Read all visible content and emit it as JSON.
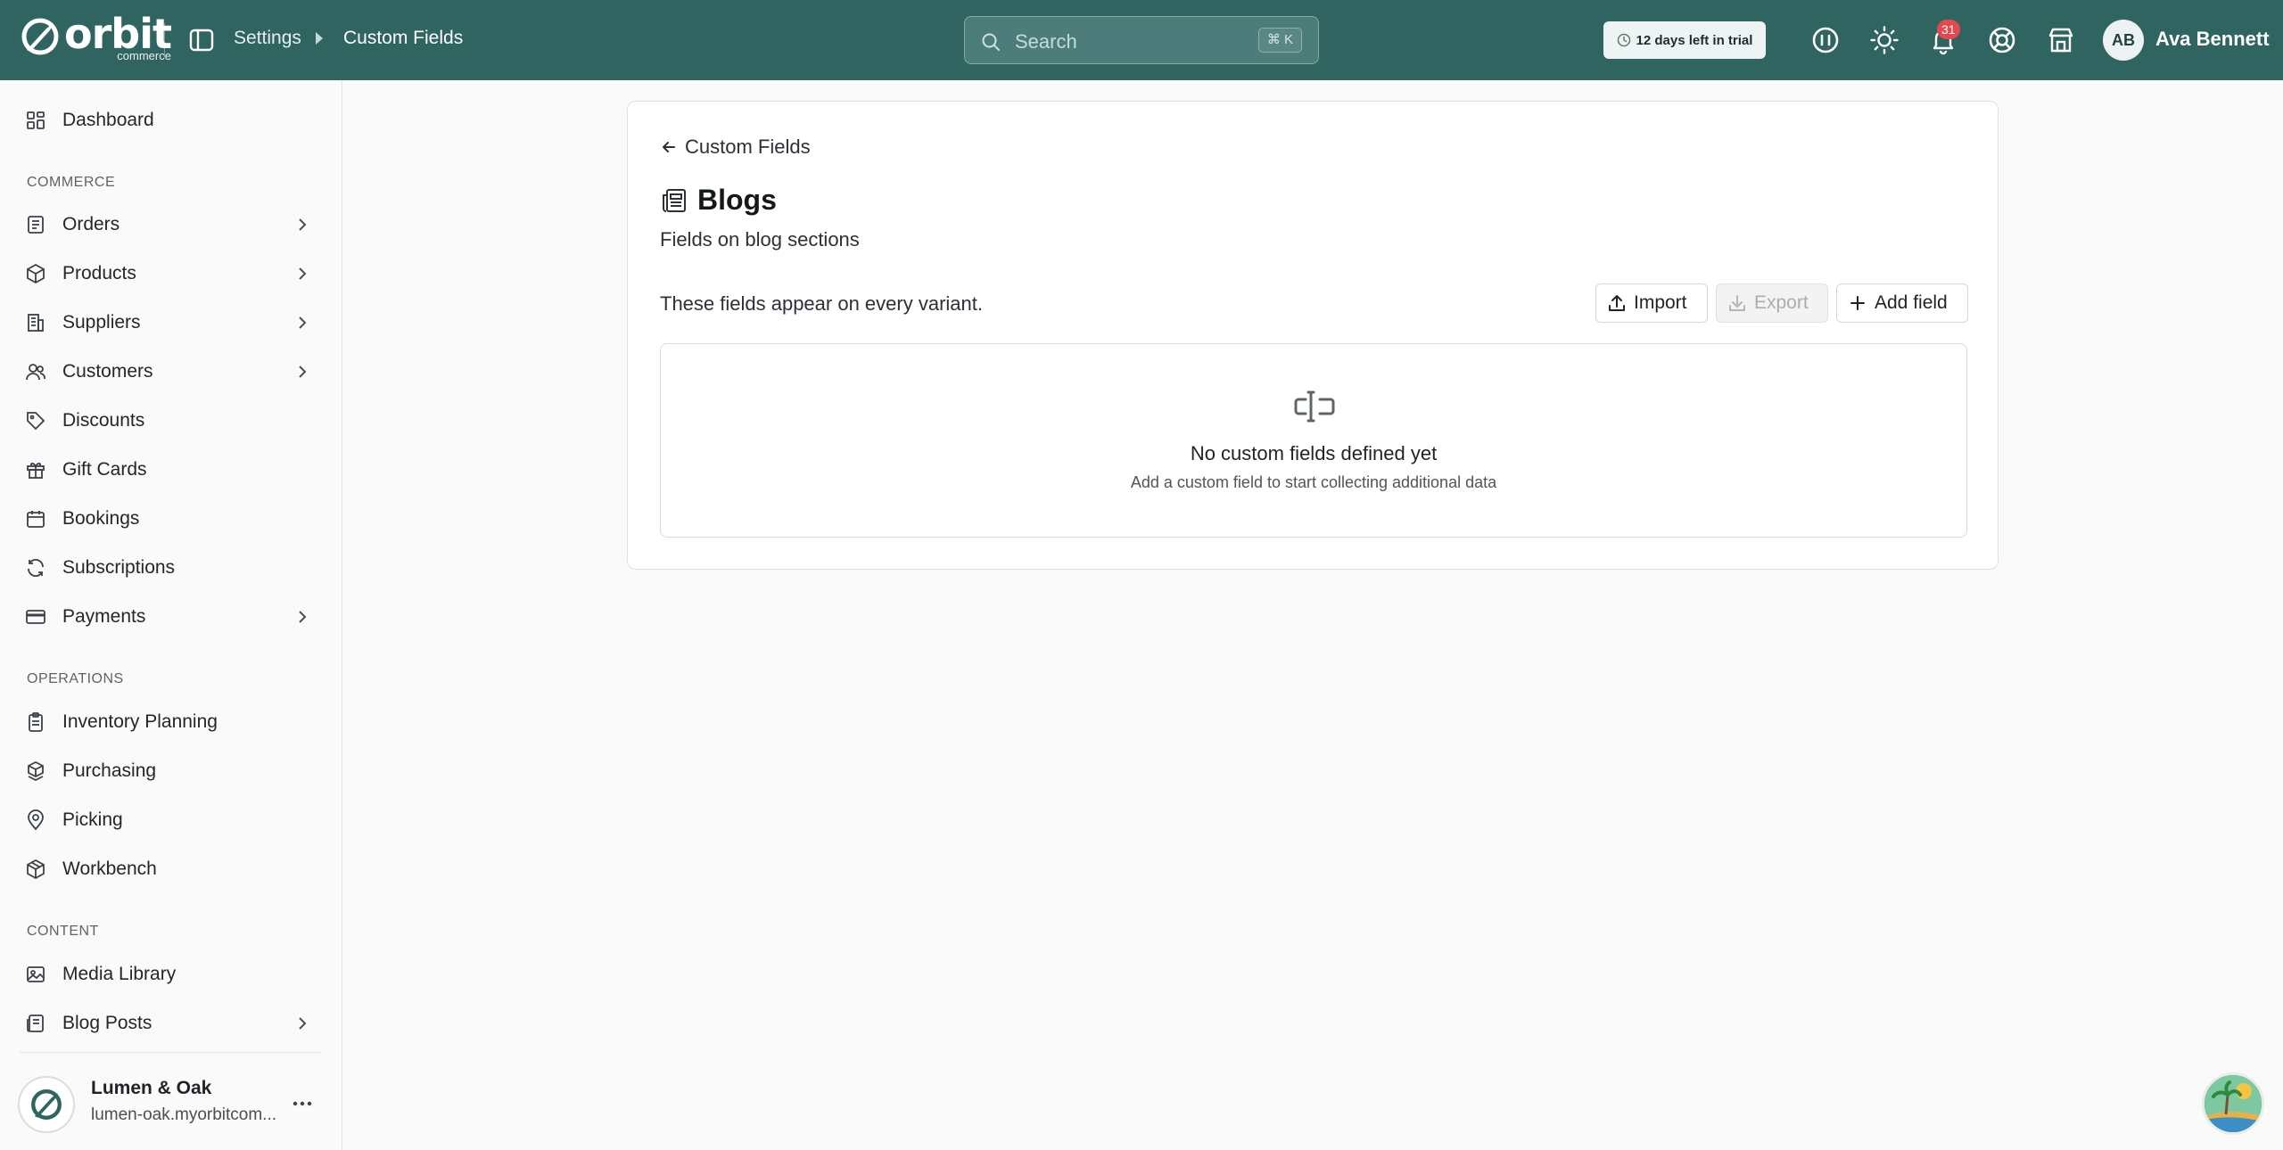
{
  "header": {
    "logo_word": "orbit",
    "logo_sub": "commerce",
    "breadcrumb": {
      "parent": "Settings",
      "current": "Custom Fields"
    },
    "search": {
      "placeholder": "Search",
      "shortcut": "⌘ K"
    },
    "trial_text": "12 days left in trial",
    "notification_count": "31",
    "user": {
      "initials": "AB",
      "name": "Ava Bennett"
    },
    "icons": [
      "sidebar-toggle-icon",
      "search-icon",
      "clock-icon",
      "feedback-icon",
      "sun-icon",
      "bell-icon",
      "help-ring-icon",
      "store-icon"
    ],
    "colors": {
      "bar": "#2f6461",
      "badge": "#e5484d"
    }
  },
  "sidebar": {
    "top_items": [
      {
        "label": "Dashboard",
        "icon": "dashboard-icon"
      }
    ],
    "sections": [
      {
        "heading": "COMMERCE",
        "items": [
          {
            "label": "Orders",
            "icon": "orders-icon",
            "expandable": true
          },
          {
            "label": "Products",
            "icon": "box-icon",
            "expandable": true
          },
          {
            "label": "Suppliers",
            "icon": "building-icon",
            "expandable": true
          },
          {
            "label": "Customers",
            "icon": "users-icon",
            "expandable": true
          },
          {
            "label": "Discounts",
            "icon": "tag-icon",
            "expandable": false
          },
          {
            "label": "Gift Cards",
            "icon": "gift-icon",
            "expandable": false
          },
          {
            "label": "Bookings",
            "icon": "calendar-icon",
            "expandable": false
          },
          {
            "label": "Subscriptions",
            "icon": "refresh-icon",
            "expandable": false
          },
          {
            "label": "Payments",
            "icon": "card-icon",
            "expandable": true
          }
        ]
      },
      {
        "heading": "OPERATIONS",
        "items": [
          {
            "label": "Inventory Planning",
            "icon": "clipboard-icon",
            "expandable": false
          },
          {
            "label": "Purchasing",
            "icon": "boxes-icon",
            "expandable": false
          },
          {
            "label": "Picking",
            "icon": "map-pin-icon",
            "expandable": false
          },
          {
            "label": "Workbench",
            "icon": "cube-icon",
            "expandable": false
          }
        ]
      },
      {
        "heading": "CONTENT",
        "items": [
          {
            "label": "Media Library",
            "icon": "image-icon",
            "expandable": false
          },
          {
            "label": "Blog Posts",
            "icon": "newspaper-icon",
            "expandable": true
          }
        ]
      }
    ],
    "store": {
      "name": "Lumen & Oak",
      "url": "lumen-oak.myorbitcom..."
    }
  },
  "main": {
    "back_label": "Custom Fields",
    "title": "Blogs",
    "subtitle": "Fields on blog sections",
    "note": "These fields appear on every variant.",
    "buttons": {
      "import": "Import",
      "export": "Export",
      "add": "Add field"
    },
    "empty": {
      "title": "No custom fields defined yet",
      "description": "Add a custom field to start collecting additional data"
    }
  }
}
